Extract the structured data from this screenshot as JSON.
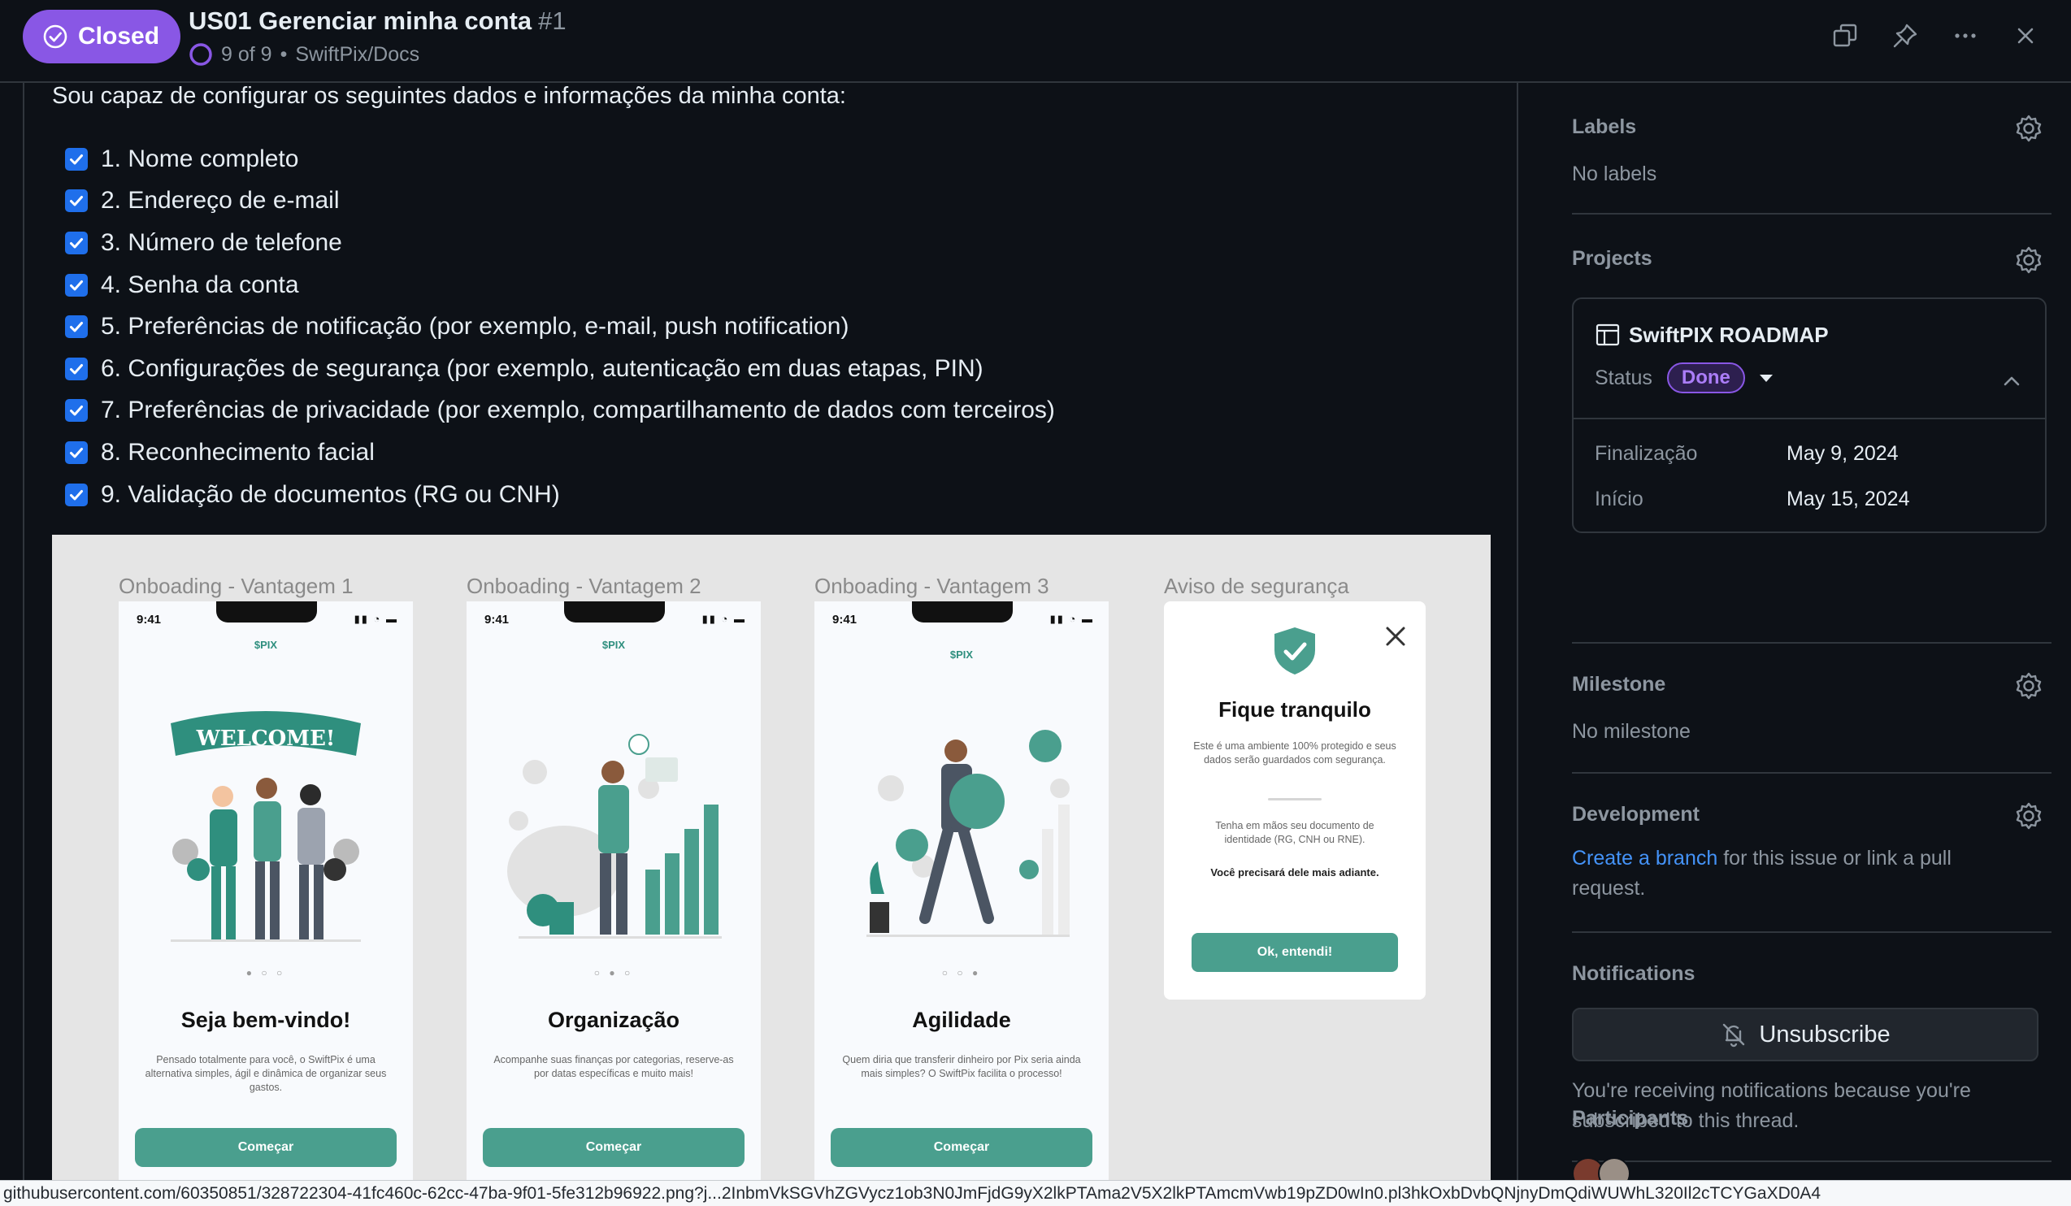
{
  "header": {
    "state_label": "Closed",
    "title": "US01 Gerenciar minha conta",
    "number": "#1",
    "progress_text": "9 of 9",
    "separator": "•",
    "repo": "SwiftPix/Docs",
    "progress_fraction": 1.0
  },
  "body": {
    "intro": "Sou capaz de configurar os seguintes dados e informações da minha conta:",
    "tasks": [
      "1. Nome completo",
      "2. Endereço de e-mail",
      "3. Número de telefone",
      "4. Senha da conta",
      "5. Preferências de notificação (por exemplo, e-mail, push notification)",
      "6. Configurações de segurança (por exemplo, autenticação em duas etapas, PIN)",
      "7. Preferências de privacidade (por exemplo, compartilhamento de dados com terceiros)",
      "8. Reconhecimento facial",
      "9. Validação de documentos (RG ou CNH)"
    ]
  },
  "mockup": {
    "frames": [
      {
        "label": "Onboading - Vantagem 1",
        "time": "9:41",
        "logo": "$PIX",
        "banner": "WELCOME!",
        "title": "Seja bem-vindo!",
        "desc": "Pensado totalmente para você, o SwiftPix é uma alternativa simples, ágil e dinâmica de organizar seus gastos.",
        "button": "Começar"
      },
      {
        "label": "Onboading - Vantagem 2",
        "time": "9:41",
        "logo": "$PIX",
        "title": "Organização",
        "desc": "Acompanhe suas finanças por categorias, reserve-as por datas específicas e muito mais!",
        "button": "Começar"
      },
      {
        "label": "Onboading - Vantagem 3",
        "time": "9:41",
        "logo": "$PIX",
        "title": "Agilidade",
        "desc": "Quem diria que transferir dinheiro por Pix seria ainda mais simples? O SwiftPix facilita o processo!",
        "button": "Começar"
      }
    ],
    "security": {
      "label": "Aviso de segurança",
      "title": "Fique tranquilo",
      "desc": "Este é uma ambiente 100% protegido e seus dados serão guardados com segurança.",
      "desc2": "Tenha em mãos seu documento de identidade (RG, CNH ou RNE).",
      "strong": "Você precisará dele mais adiante.",
      "button": "Ok, entendi!"
    }
  },
  "sidebar": {
    "labels": {
      "title": "Labels",
      "value": "No labels"
    },
    "projects": {
      "title": "Projects",
      "project_name": "SwiftPIX ROADMAP",
      "status_label": "Status",
      "status_value": "Done",
      "fields": [
        {
          "name": "Finalização",
          "value": "May 9, 2024"
        },
        {
          "name": "Início",
          "value": "May 15, 2024"
        }
      ]
    },
    "milestone": {
      "title": "Milestone",
      "value": "No milestone"
    },
    "development": {
      "title": "Development",
      "link_text": "Create a branch",
      "rest_text": " for this issue or link a pull request."
    },
    "notifications": {
      "title": "Notifications",
      "button": "Unsubscribe",
      "text": "You're receiving notifications because you're subscribed to this thread."
    },
    "participants": {
      "title": "Participants"
    }
  },
  "status_url": "githubusercontent.com/60350851/328722304-41fc460c-62cc-47ba-9f01-5fe312b96922.png?j...2InbmVkSGVhZGVycz1ob3N0JmFjdG9yX2lkPTAma2V5X2lkPTAmcmVwb19pZD0wIn0.pl3hkOxbDvbQNjnyDmQdiWUWhL320Il2cTCYGaXD0A4",
  "colors": {
    "closed": "#8957e5",
    "accent_blue": "#1f6feb",
    "link": "#4493f8",
    "brand_green": "#4a9f8e"
  },
  "icons": [
    "closed-check-icon",
    "progress-ring-icon",
    "copy-icon",
    "pin-icon",
    "more-icon",
    "close-icon",
    "checkbox-icon",
    "gear-icon",
    "table-icon",
    "chevron-up-icon",
    "bell-slash-icon",
    "shield-check-icon"
  ]
}
